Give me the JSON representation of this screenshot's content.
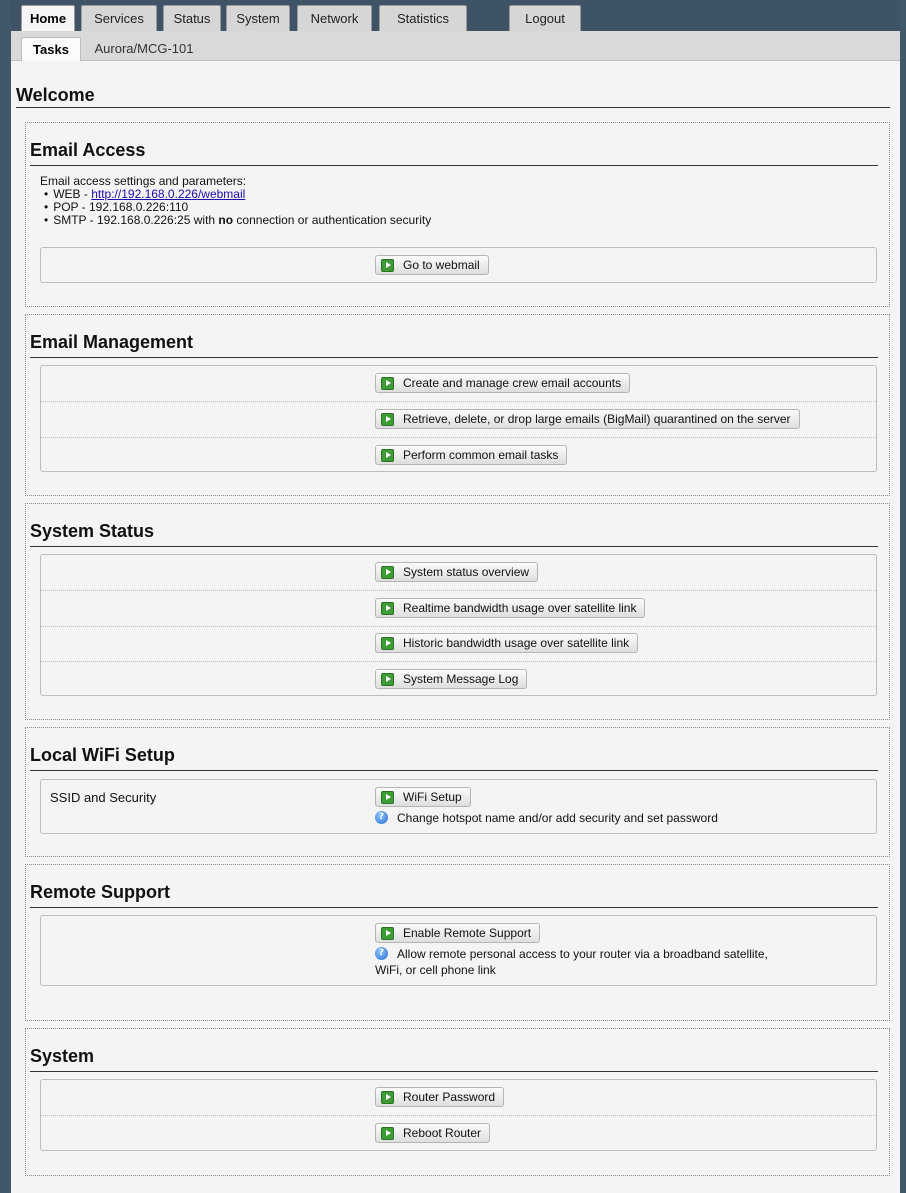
{
  "tabs": [
    "Home",
    "Services",
    "Status",
    "System",
    "Network",
    "Statistics",
    "Logout"
  ],
  "subtabs": [
    "Tasks",
    "Aurora/MCG-101"
  ],
  "page_title": "Welcome",
  "email_access": {
    "title": "Email Access",
    "intro": "Email access settings and parameters:",
    "web_prefix": "WEB - ",
    "web_link": "http://192.168.0.226/webmail",
    "pop": "POP - 192.168.0.226:110",
    "smtp_prefix": "SMTP - 192.168.0.226:25 with ",
    "smtp_bold": "no",
    "smtp_suffix": " connection or authentication security",
    "button": "Go to webmail"
  },
  "email_management": {
    "title": "Email Management",
    "buttons": [
      "Create and manage crew email accounts",
      "Retrieve, delete, or drop large emails (BigMail) quarantined on the server",
      "Perform common email tasks"
    ]
  },
  "system_status": {
    "title": "System Status",
    "buttons": [
      "System status overview",
      "Realtime bandwidth usage over satellite link",
      "Historic bandwidth usage over satellite link",
      "System Message Log"
    ]
  },
  "wifi": {
    "title": "Local WiFi Setup",
    "label": "SSID and Security",
    "button": "WiFi Setup",
    "help": "Change hotspot name and/or add security and set password"
  },
  "remote_support": {
    "title": "Remote Support",
    "button": "Enable Remote Support",
    "help_line1": "Allow remote personal access to your router via a broadband satellite,",
    "help_line2": "WiFi, or cell phone link"
  },
  "system": {
    "title": "System",
    "buttons": [
      "Router Password",
      "Reboot Router"
    ]
  },
  "colors": {
    "frame": "#3e5366",
    "content_bg": "#f4f4f4",
    "go_icon": "#3f9b36",
    "help_icon": "#2a6fd0",
    "link": "#1a0dab"
  },
  "icons": {
    "button_icon": "go-arrow-icon",
    "help": "help-icon"
  }
}
